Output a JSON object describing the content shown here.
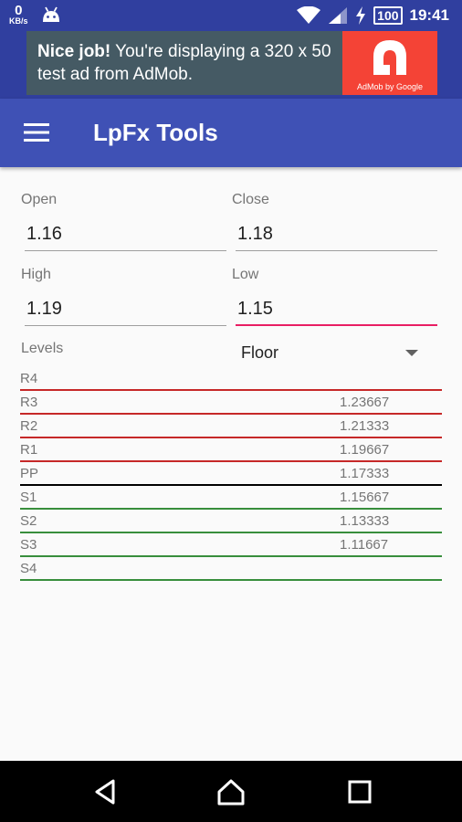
{
  "status_bar": {
    "net_speed": "0",
    "net_unit": "KB/s",
    "battery": "100",
    "time": "19:41"
  },
  "ad": {
    "bold": "Nice job!",
    "text": " You're displaying a 320 x 50 test ad from AdMob.",
    "logo_caption": "AdMob by Google"
  },
  "toolbar": {
    "title": "LpFx Tools"
  },
  "form": {
    "open_label": "Open",
    "open_value": "1.16",
    "close_label": "Close",
    "close_value": "1.18",
    "high_label": "High",
    "high_value": "1.19",
    "low_label": "Low",
    "low_value": "1.15",
    "levels_label": "Levels",
    "method_selected": "Floor"
  },
  "levels": [
    {
      "name": "R4",
      "value": "",
      "color": "#c62828"
    },
    {
      "name": "R3",
      "value": "1.23667",
      "color": "#c62828"
    },
    {
      "name": "R2",
      "value": "1.21333",
      "color": "#c62828"
    },
    {
      "name": "R1",
      "value": "1.19667",
      "color": "#c62828"
    },
    {
      "name": "PP",
      "value": "1.17333",
      "color": "#000000"
    },
    {
      "name": "S1",
      "value": "1.15667",
      "color": "#388e3c"
    },
    {
      "name": "S2",
      "value": "1.13333",
      "color": "#388e3c"
    },
    {
      "name": "S3",
      "value": "1.11667",
      "color": "#388e3c"
    },
    {
      "name": "S4",
      "value": "",
      "color": "#388e3c"
    }
  ],
  "colors": {
    "primary": "#3f51b5",
    "primary_dark": "#303f9f",
    "accent": "#e91e63",
    "resistance": "#c62828",
    "pivot": "#000000",
    "support": "#388e3c"
  },
  "icons": {
    "menu": "hamburger-icon",
    "back": "back-icon",
    "home": "home-icon",
    "recents": "recents-icon"
  }
}
